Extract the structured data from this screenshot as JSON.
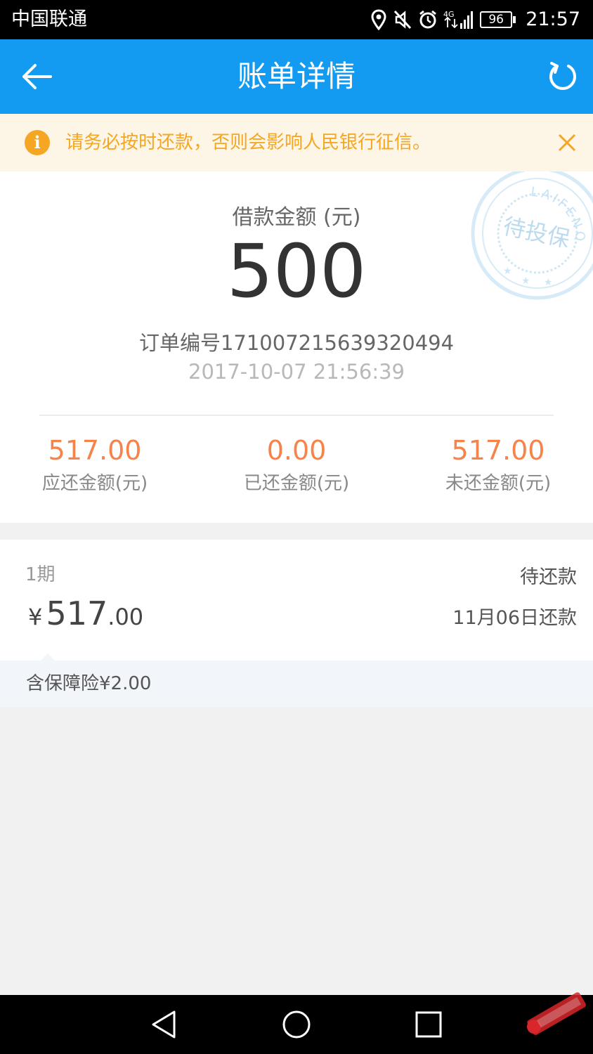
{
  "status_bar": {
    "carrier": "中国联通",
    "network": "4G",
    "battery": "96",
    "time": "21:57"
  },
  "header": {
    "title": "账单详情",
    "back_icon": "arrow-left-icon",
    "refresh_icon": "refresh-icon"
  },
  "notice": {
    "text": "请务必按时还款，否则会影响人民银行征信。",
    "icon": "info-icon",
    "color": "#f5a623"
  },
  "loan": {
    "label": "借款金额 (元)",
    "amount": "500",
    "order_no": "订单编号171007215639320494",
    "order_time": "2017-10-07 21:56:39",
    "stamp_text": "待投保",
    "stamp_ring": "LAIFENQI"
  },
  "stats": [
    {
      "value": "517.00",
      "label": "应还金额(元)"
    },
    {
      "value": "0.00",
      "label": "已还金额(元)"
    },
    {
      "value": "517.00",
      "label": "未还金额(元)"
    }
  ],
  "installment": {
    "period": "1期",
    "currency": "¥",
    "amount_int": "517",
    "amount_dec": ".00",
    "status": "待还款",
    "due": "11月06日还款"
  },
  "insurance": {
    "text": "含保障险¥2.00"
  },
  "colors": {
    "app_bar": "#139bf2",
    "accent_orange": "#f5834a"
  }
}
